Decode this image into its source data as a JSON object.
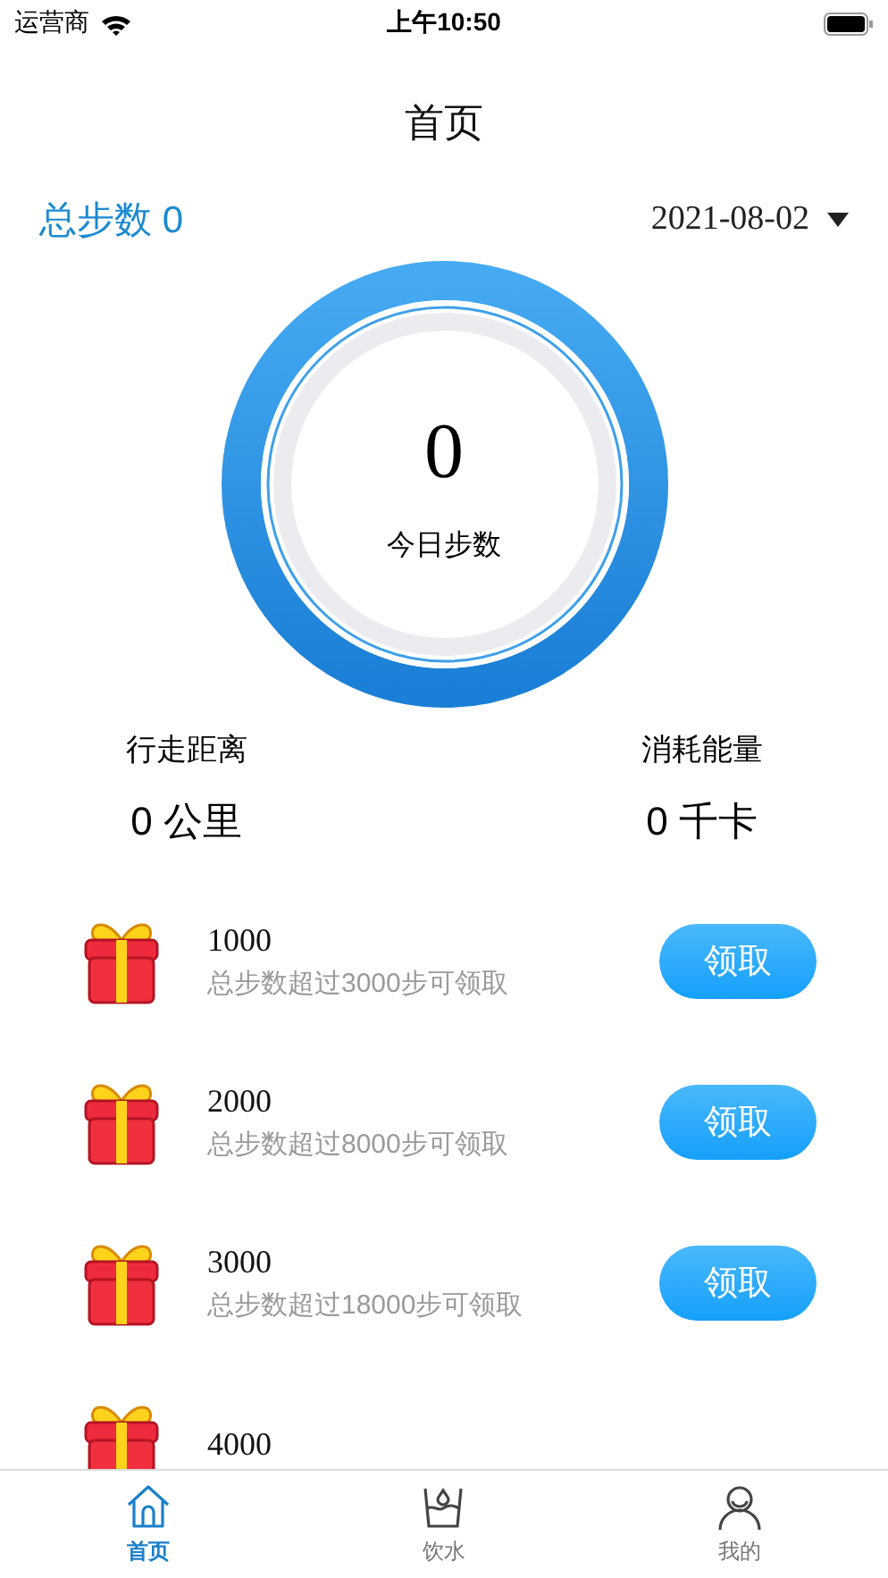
{
  "status_bar": {
    "carrier": "运营商",
    "time": "上午10:50"
  },
  "header": {
    "title": "首页"
  },
  "summary": {
    "total_steps": "总步数 0",
    "date": "2021-08-02"
  },
  "ring": {
    "steps": "0",
    "label": "今日步数"
  },
  "stats": [
    {
      "label": "行走距离",
      "value": "0 公里"
    },
    {
      "label": "消耗能量",
      "value": "0 千卡"
    }
  ],
  "rewards": [
    {
      "amount": "1000",
      "condition": "总步数超过3000步可领取",
      "button": "领取"
    },
    {
      "amount": "2000",
      "condition": "总步数超过8000步可领取",
      "button": "领取"
    },
    {
      "amount": "3000",
      "condition": "总步数超过18000步可领取",
      "button": "领取"
    },
    {
      "amount": "4000"
    }
  ],
  "tab_bar": [
    {
      "label": "首页",
      "kind": "home",
      "selected": true
    },
    {
      "label": "饮水",
      "kind": "water",
      "selected": false
    },
    {
      "label": "我的",
      "kind": "profile",
      "selected": false
    }
  ]
}
